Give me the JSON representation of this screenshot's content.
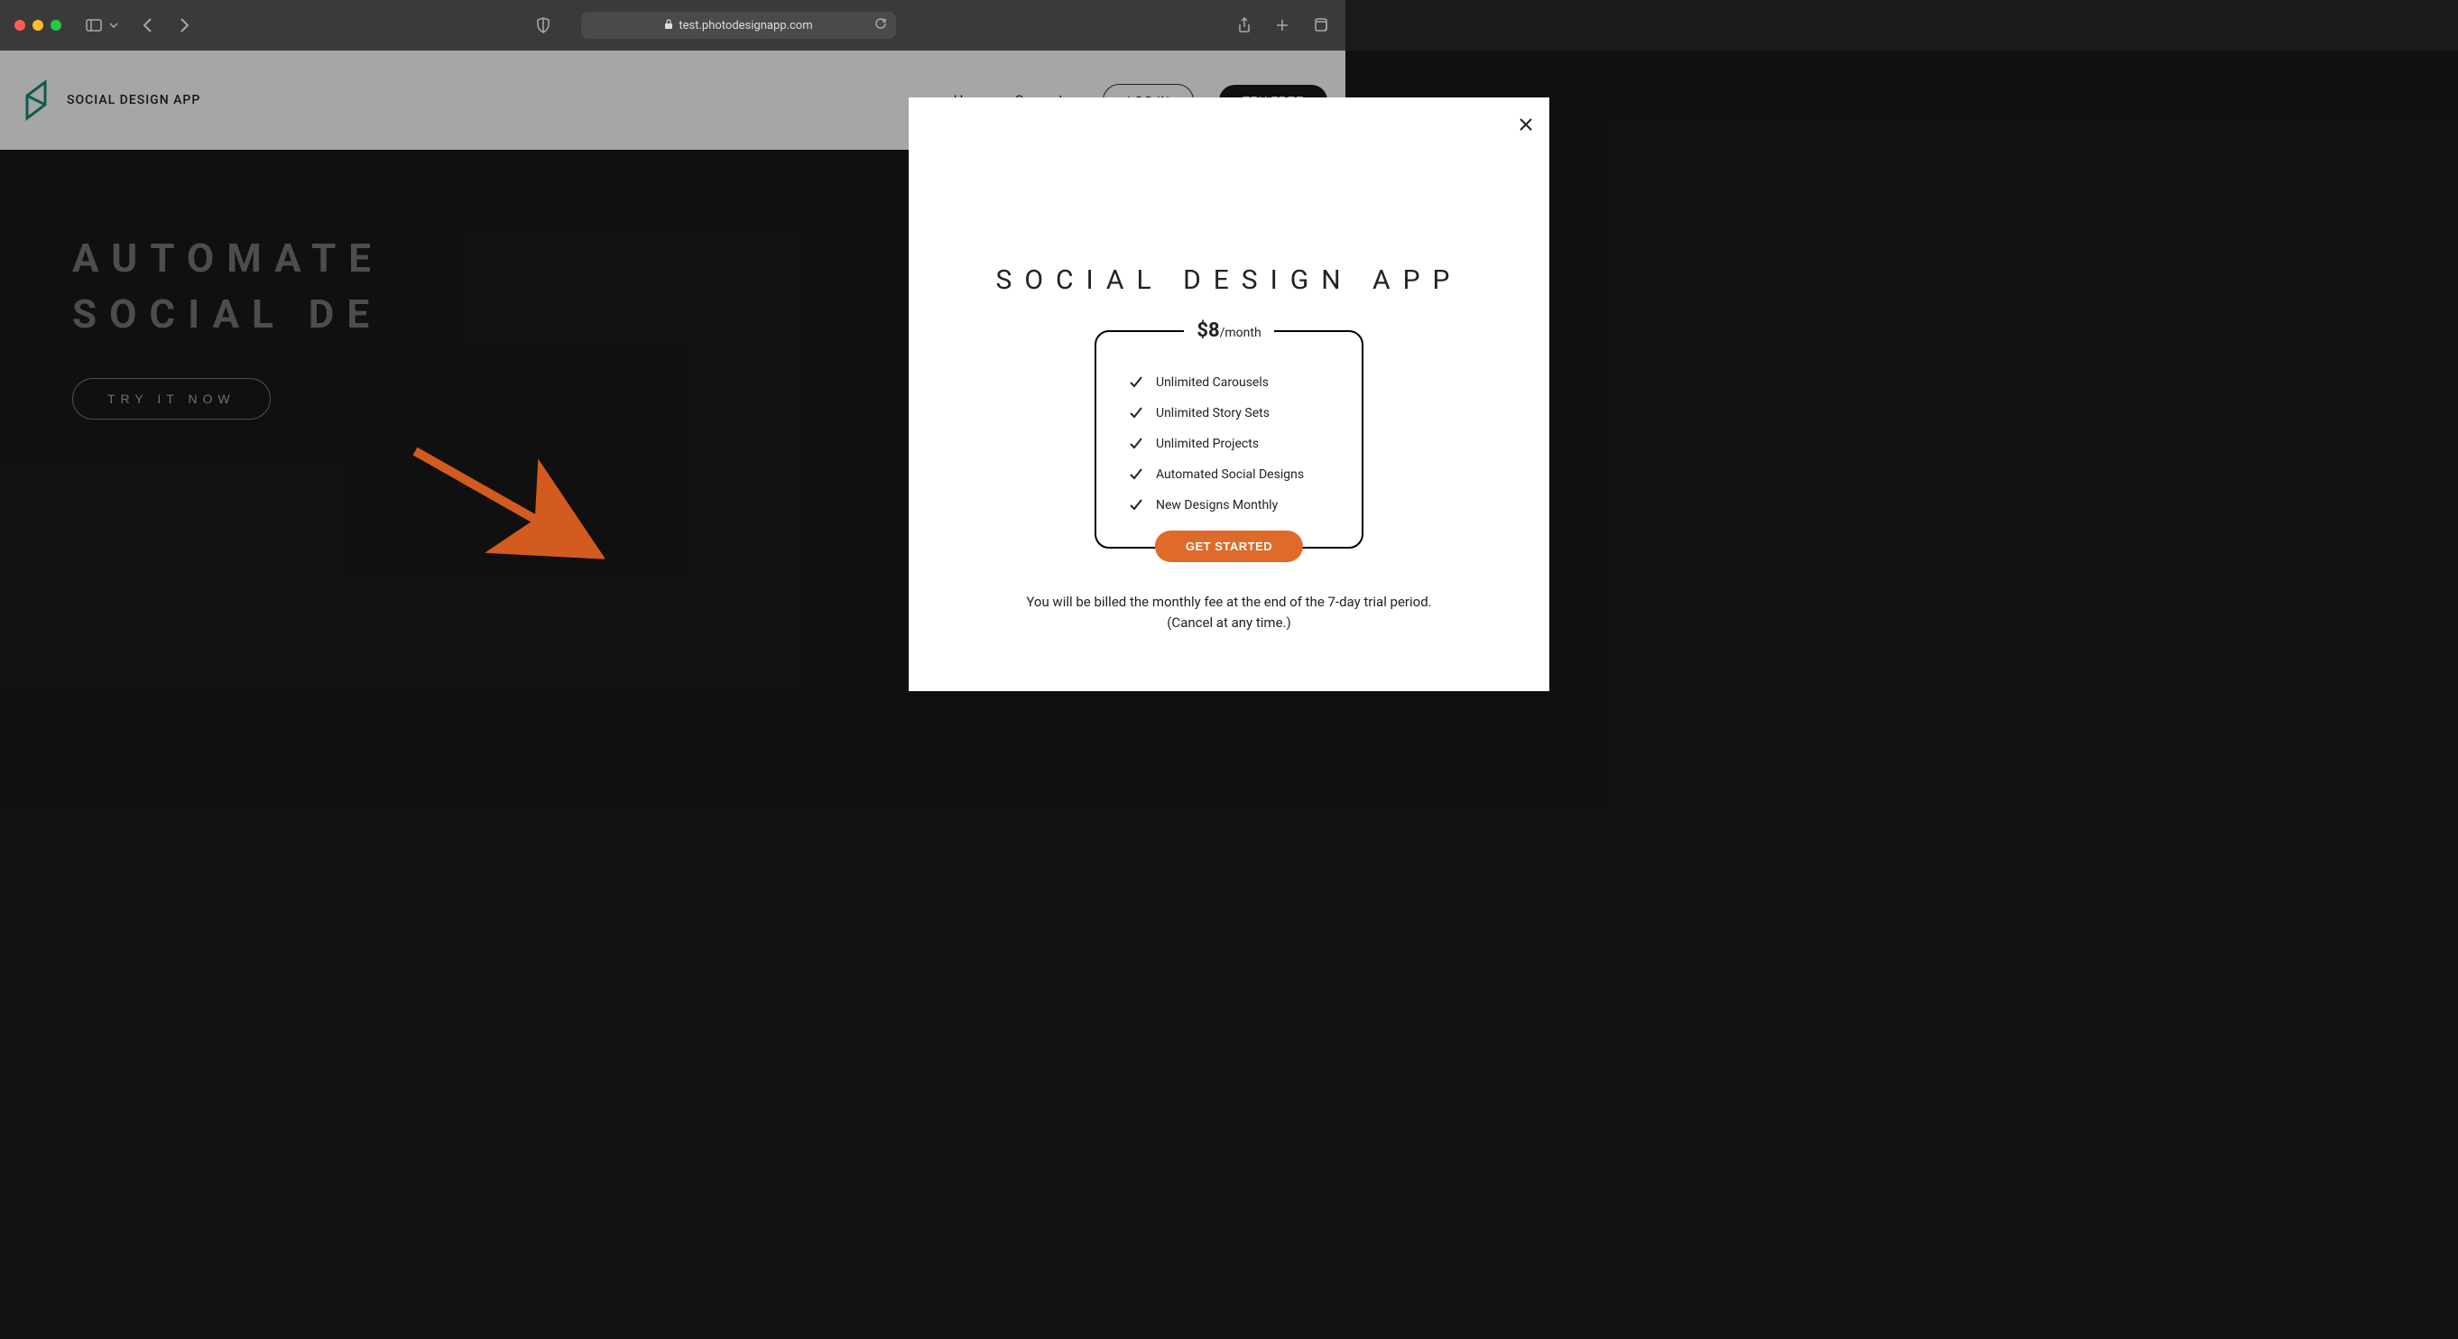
{
  "browser": {
    "url": "test.photodesignapp.com"
  },
  "header": {
    "brand": "SOCIAL DESIGN APP",
    "nav": {
      "home": "Home",
      "support": "Support",
      "login": "LOG IN",
      "tryfree": "TRY FREE"
    }
  },
  "hero": {
    "line1": "AUTOMATE",
    "line2": "SOCIAL DE",
    "cta": "TRY IT NOW"
  },
  "modal": {
    "title": "SOCIAL DESIGN APP",
    "price_main": "$8",
    "price_unit": "/month",
    "features": [
      "Unlimited Carousels",
      "Unlimited Story Sets",
      "Unlimited Projects",
      "Automated Social Designs",
      "New Designs Monthly"
    ],
    "cta": "GET STARTED",
    "footnote_line1": "You will be billed the monthly fee at the end of the 7-day trial period.",
    "footnote_line2": "(Cancel at any time.)"
  }
}
